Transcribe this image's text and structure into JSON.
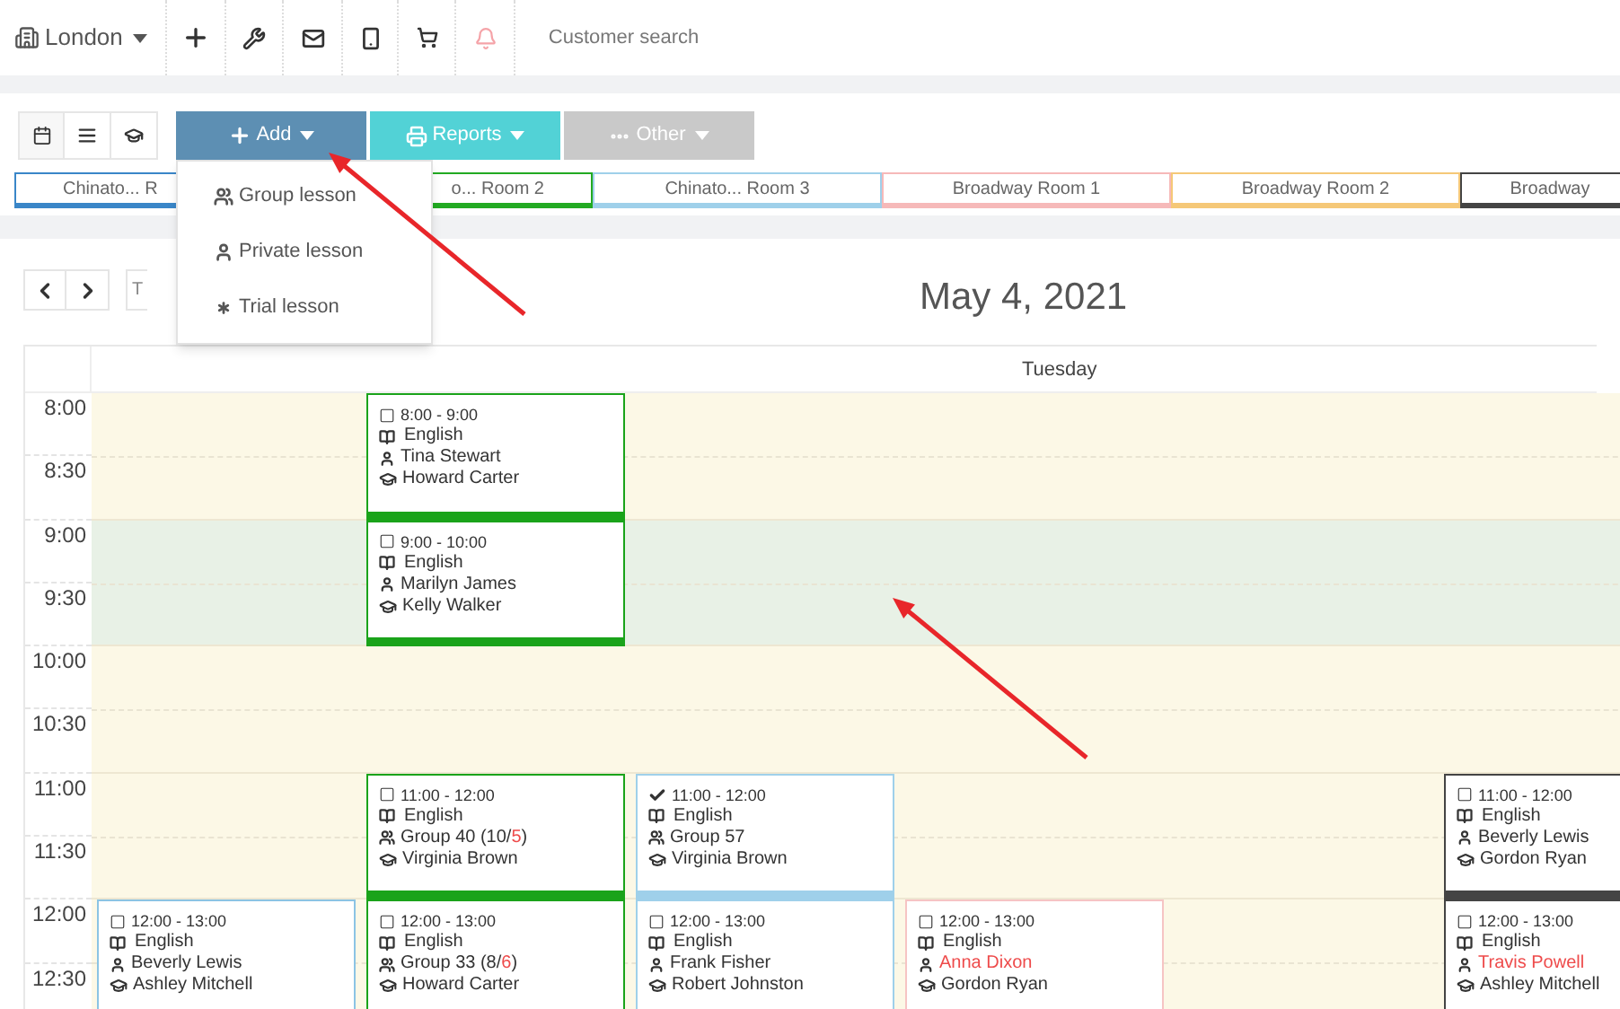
{
  "top_bar": {
    "location": "London",
    "search": {
      "placeholder": "Customer search"
    }
  },
  "actions": [
    {
      "label": "Add",
      "kind": "add"
    },
    {
      "label": "Reports",
      "kind": "reports"
    },
    {
      "label": "Other",
      "kind": "other"
    }
  ],
  "add_menu": [
    {
      "label": "Group lesson",
      "kind": "group"
    },
    {
      "label": "Private lesson",
      "kind": "private"
    },
    {
      "label": "Trial lesson",
      "kind": "trial"
    }
  ],
  "rooms": [
    {
      "label": "Chinato... R",
      "color": "#3a86c8"
    },
    {
      "label": "o... Room 2",
      "color": "#22aa22"
    },
    {
      "label": "Chinato... Room 3",
      "color": "#9fd0ea"
    },
    {
      "label": "Broadway Room 1",
      "color": "#f6b9b9"
    },
    {
      "label": "Broadway Room 2",
      "color": "#f5c878"
    },
    {
      "label": "Broadway",
      "color": "#444444"
    }
  ],
  "today_button": "T",
  "date": "May 4, 2021",
  "day": "Tuesday",
  "hours": [
    {
      "labels": [
        "8:00",
        "8:30"
      ],
      "highlighted": false,
      "lanes": [
        {
          "kind": "empty"
        },
        {
          "kind": "lesson",
          "done": false,
          "time": "8:00 - 9:00",
          "subject": "English",
          "participant": {
            "kind": "single",
            "parts": [
              {
                "text": "Tina Stewart",
                "alert": false
              }
            ]
          },
          "teacher": "Howard Carter",
          "color": "#1aa31a"
        },
        {
          "kind": "empty"
        },
        {
          "kind": "empty"
        },
        {
          "kind": "empty"
        },
        {
          "kind": "empty"
        }
      ]
    },
    {
      "labels": [
        "9:00",
        "9:30"
      ],
      "highlighted": true,
      "lanes": [
        {
          "kind": "empty"
        },
        {
          "kind": "lesson",
          "done": false,
          "time": "9:00 - 10:00",
          "subject": "English",
          "participant": {
            "kind": "single",
            "parts": [
              {
                "text": "Marilyn James",
                "alert": false
              }
            ]
          },
          "teacher": "Kelly Walker",
          "color": "#1aa31a"
        },
        {
          "kind": "empty"
        },
        {
          "kind": "empty"
        },
        {
          "kind": "empty"
        },
        {
          "kind": "empty"
        }
      ]
    },
    {
      "labels": [
        "10:00",
        "10:30"
      ],
      "highlighted": false,
      "lanes": [
        {
          "kind": "empty"
        },
        {
          "kind": "empty"
        },
        {
          "kind": "empty"
        },
        {
          "kind": "empty"
        },
        {
          "kind": "empty"
        },
        {
          "kind": "empty"
        }
      ]
    },
    {
      "labels": [
        "11:00",
        "11:30"
      ],
      "highlighted": false,
      "lanes": [
        {
          "kind": "empty"
        },
        {
          "kind": "lesson",
          "done": false,
          "time": "11:00 - 12:00",
          "subject": "English",
          "participant": {
            "kind": "group",
            "parts": [
              {
                "text": "Group 40 (10/",
                "alert": false
              },
              {
                "text": "5",
                "alert": true
              },
              {
                "text": ")",
                "alert": false
              }
            ]
          },
          "teacher": "Virginia Brown",
          "color": "#1aa31a"
        },
        {
          "kind": "lesson",
          "done": true,
          "time": "11:00 - 12:00",
          "subject": "English",
          "participant": {
            "kind": "group",
            "parts": [
              {
                "text": "Group 57",
                "alert": false
              }
            ]
          },
          "teacher": "Virginia Brown",
          "color": "#9fd0ea"
        },
        {
          "kind": "empty"
        },
        {
          "kind": "empty"
        },
        {
          "kind": "lesson",
          "done": false,
          "time": "11:00 - 12:00",
          "subject": "English",
          "participant": {
            "kind": "single",
            "parts": [
              {
                "text": "Beverly Lewis",
                "alert": false
              }
            ]
          },
          "teacher": "Gordon Ryan",
          "color": "#444444"
        }
      ]
    },
    {
      "labels": [
        "12:00",
        "12:30"
      ],
      "highlighted": false,
      "lanes": [
        {
          "kind": "lesson",
          "done": false,
          "time": "12:00 - 13:00",
          "subject": "English",
          "participant": {
            "kind": "single",
            "parts": [
              {
                "text": "Beverly Lewis",
                "alert": false
              }
            ]
          },
          "teacher": "Ashley Mitchell",
          "color": "#8cc4e4"
        },
        {
          "kind": "lesson",
          "done": false,
          "time": "12:00 - 13:00",
          "subject": "English",
          "participant": {
            "kind": "group",
            "parts": [
              {
                "text": "Group 33 (8/",
                "alert": false
              },
              {
                "text": "6",
                "alert": true
              },
              {
                "text": ")",
                "alert": false
              }
            ]
          },
          "teacher": "Howard Carter",
          "color": "#1aa31a"
        },
        {
          "kind": "lesson",
          "done": false,
          "time": "12:00 - 13:00",
          "subject": "English",
          "participant": {
            "kind": "single",
            "parts": [
              {
                "text": "Frank Fisher",
                "alert": false
              }
            ]
          },
          "teacher": "Robert Johnston",
          "color": "#9fd0ea"
        },
        {
          "kind": "lesson",
          "done": false,
          "time": "12:00 - 13:00",
          "subject": "English",
          "participant": {
            "kind": "single",
            "parts": [
              {
                "text": "Anna Dixon",
                "alert": true
              }
            ]
          },
          "teacher": "Gordon Ryan",
          "color": "#f6c4c4"
        },
        {
          "kind": "empty"
        },
        {
          "kind": "lesson",
          "done": false,
          "time": "12:00 - 13:00",
          "subject": "English",
          "participant": {
            "kind": "single",
            "parts": [
              {
                "text": "Travis Powell",
                "alert": true
              }
            ]
          },
          "teacher": "Ashley Mitchell",
          "color": "#444444"
        }
      ]
    }
  ]
}
